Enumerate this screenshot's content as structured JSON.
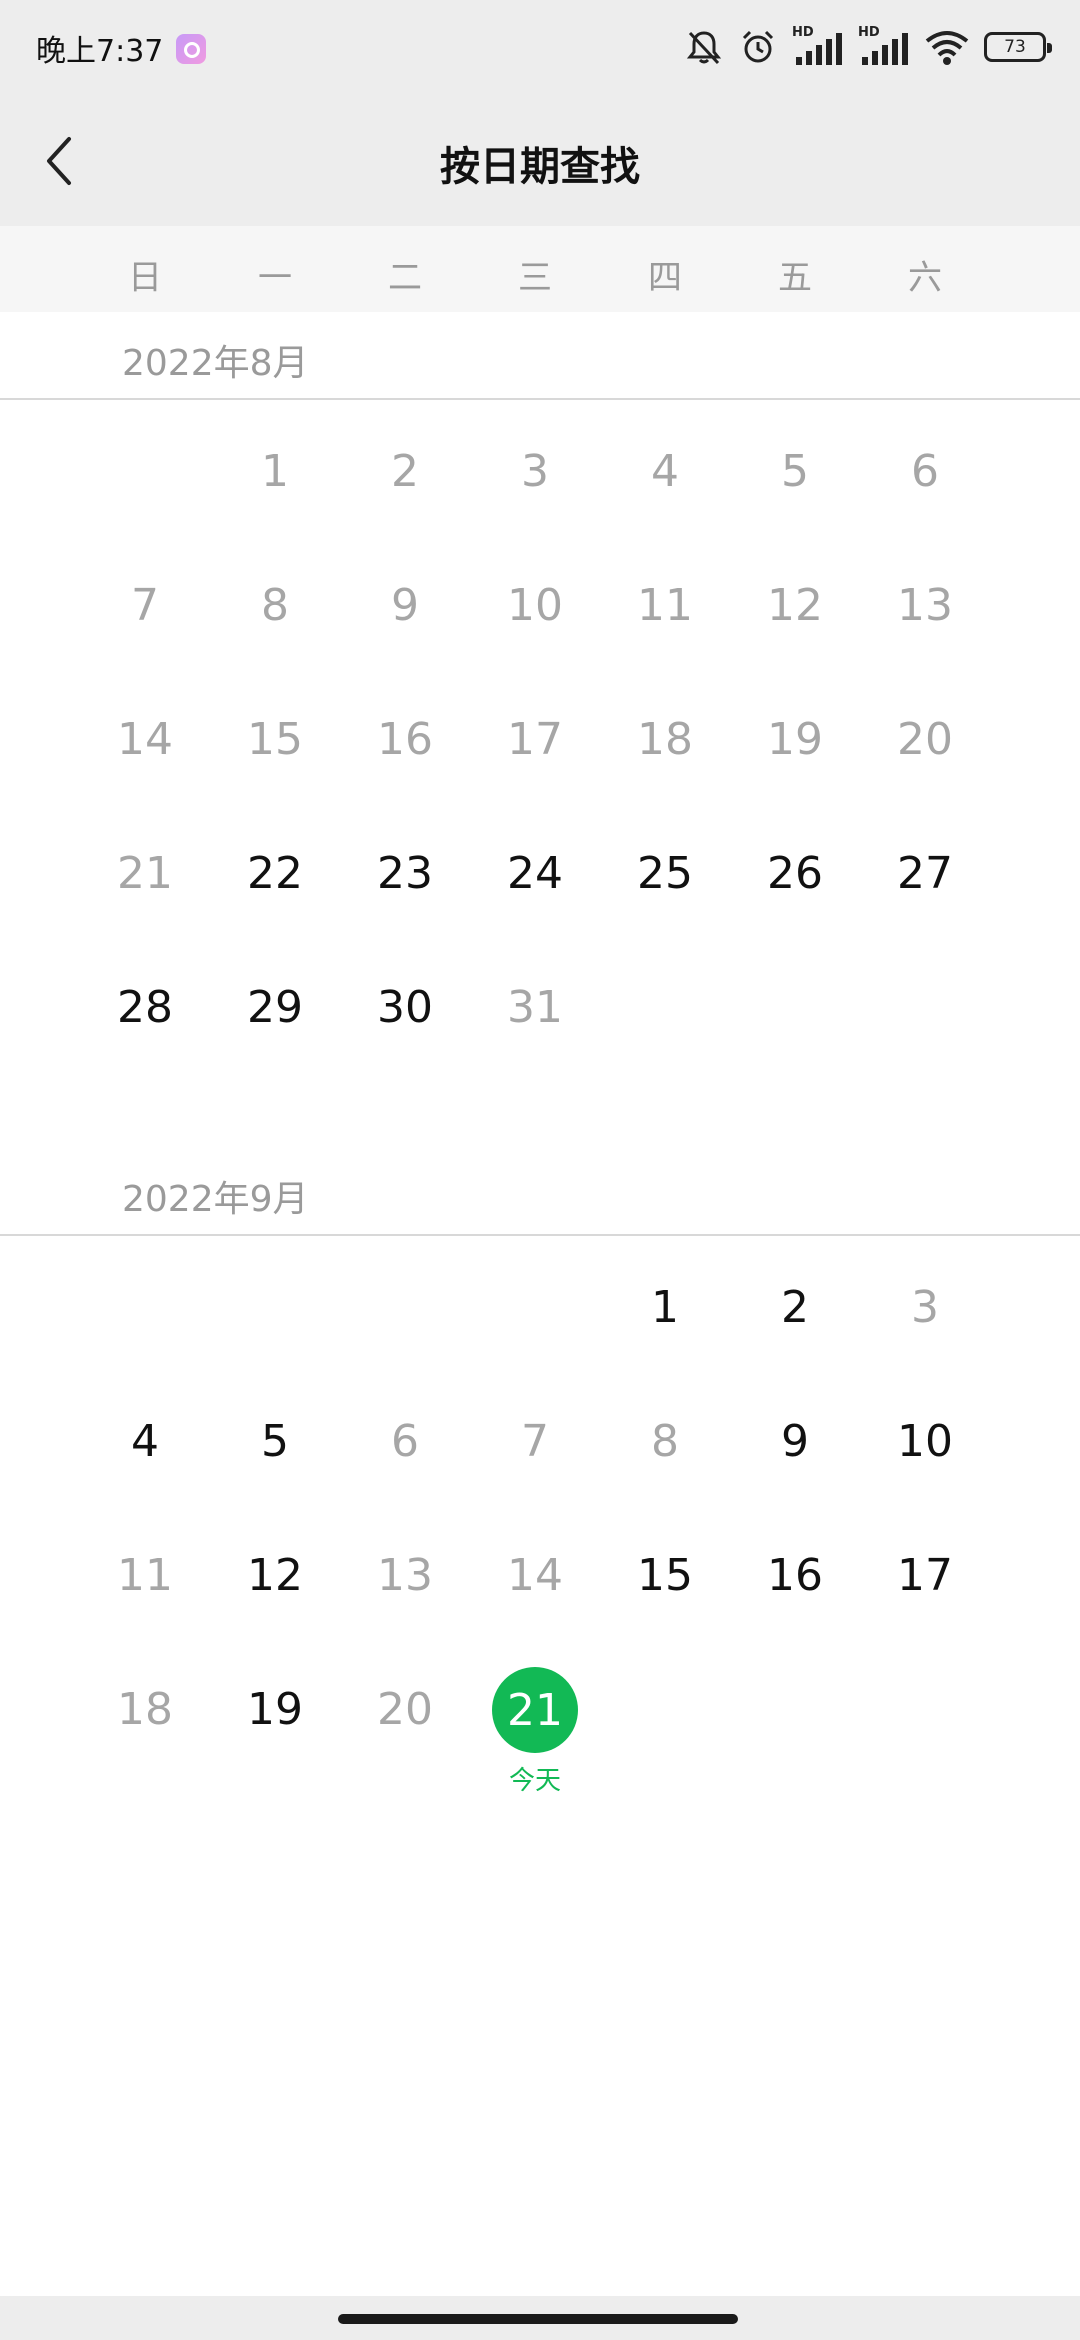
{
  "status_bar": {
    "time": "晚上7:37",
    "battery": "73",
    "network_label_1": "HD",
    "network_label_2": "HD"
  },
  "header": {
    "title": "按日期查找"
  },
  "weekdays": [
    "日",
    "一",
    "二",
    "三",
    "四",
    "五",
    "六"
  ],
  "months": [
    {
      "title": "2022年8月",
      "weeks": [
        [
          null,
          {
            "d": "1",
            "on": false
          },
          {
            "d": "2",
            "on": false
          },
          {
            "d": "3",
            "on": false
          },
          {
            "d": "4",
            "on": false
          },
          {
            "d": "5",
            "on": false
          },
          {
            "d": "6",
            "on": false
          }
        ],
        [
          {
            "d": "7",
            "on": false
          },
          {
            "d": "8",
            "on": false
          },
          {
            "d": "9",
            "on": false
          },
          {
            "d": "10",
            "on": false
          },
          {
            "d": "11",
            "on": false
          },
          {
            "d": "12",
            "on": false
          },
          {
            "d": "13",
            "on": false
          }
        ],
        [
          {
            "d": "14",
            "on": false
          },
          {
            "d": "15",
            "on": false
          },
          {
            "d": "16",
            "on": false
          },
          {
            "d": "17",
            "on": false
          },
          {
            "d": "18",
            "on": false
          },
          {
            "d": "19",
            "on": false
          },
          {
            "d": "20",
            "on": false
          }
        ],
        [
          {
            "d": "21",
            "on": false
          },
          {
            "d": "22",
            "on": true
          },
          {
            "d": "23",
            "on": true
          },
          {
            "d": "24",
            "on": true
          },
          {
            "d": "25",
            "on": true
          },
          {
            "d": "26",
            "on": true
          },
          {
            "d": "27",
            "on": true
          }
        ],
        [
          {
            "d": "28",
            "on": true
          },
          {
            "d": "29",
            "on": true
          },
          {
            "d": "30",
            "on": true
          },
          {
            "d": "31",
            "on": false
          },
          null,
          null,
          null
        ]
      ]
    },
    {
      "title": "2022年9月",
      "weeks": [
        [
          null,
          null,
          null,
          null,
          {
            "d": "1",
            "on": true
          },
          {
            "d": "2",
            "on": true
          },
          {
            "d": "3",
            "on": false
          }
        ],
        [
          {
            "d": "4",
            "on": true
          },
          {
            "d": "5",
            "on": true
          },
          {
            "d": "6",
            "on": false
          },
          {
            "d": "7",
            "on": false
          },
          {
            "d": "8",
            "on": false
          },
          {
            "d": "9",
            "on": true
          },
          {
            "d": "10",
            "on": true
          }
        ],
        [
          {
            "d": "11",
            "on": false
          },
          {
            "d": "12",
            "on": true
          },
          {
            "d": "13",
            "on": false
          },
          {
            "d": "14",
            "on": false
          },
          {
            "d": "15",
            "on": true
          },
          {
            "d": "16",
            "on": true
          },
          {
            "d": "17",
            "on": true
          }
        ],
        [
          {
            "d": "18",
            "on": false
          },
          {
            "d": "19",
            "on": true
          },
          {
            "d": "20",
            "on": false
          },
          {
            "d": "21",
            "on": true,
            "today": true
          },
          null,
          null,
          null
        ]
      ]
    }
  ],
  "today_label": "今天",
  "colors": {
    "accent": "#12b955",
    "active_text": "#111111",
    "dim_text": "#a6a6a6",
    "bar_bg": "#ededed"
  }
}
